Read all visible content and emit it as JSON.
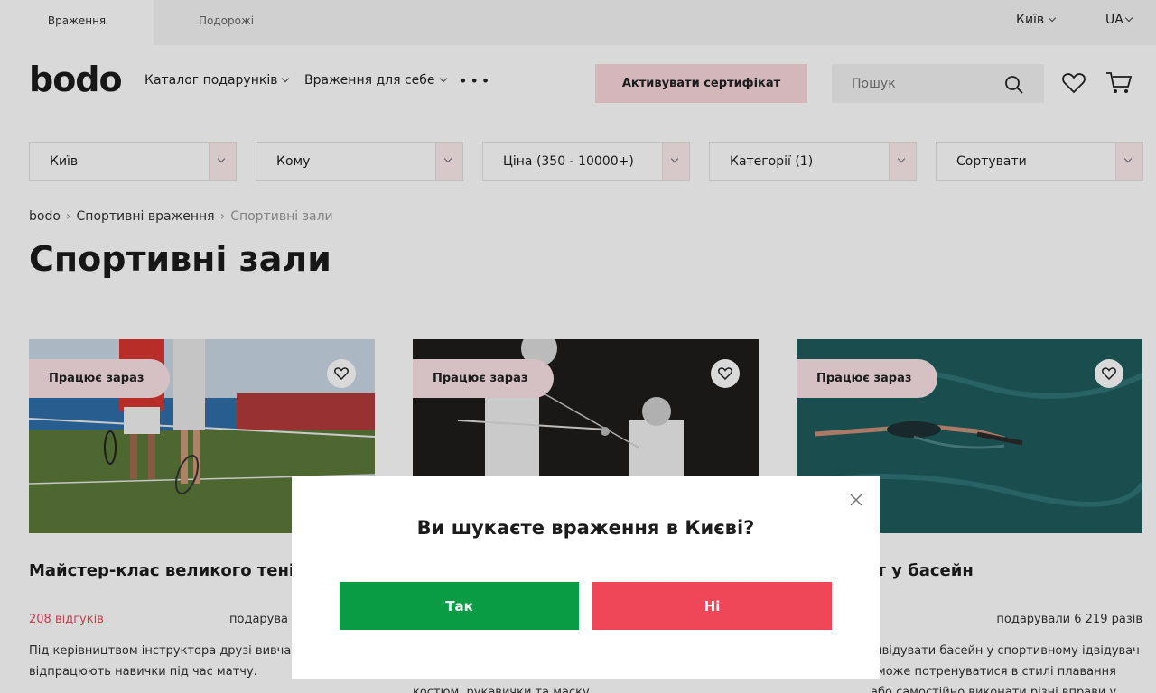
{
  "topbar": {
    "tabs": [
      "Враження",
      "Подорожі"
    ],
    "city": "Київ",
    "language": "UA"
  },
  "header": {
    "logo": "bodo",
    "nav": [
      "Каталог подарунків",
      "Враження для себе"
    ],
    "more_icon": "ellipsis-icon",
    "activate_label": "Активувати сертифікат",
    "search_placeholder": "Пошук",
    "icons": [
      "search-icon",
      "heart-icon",
      "cart-icon"
    ]
  },
  "filters": [
    {
      "label": "Київ"
    },
    {
      "label": "Кому"
    },
    {
      "label": "Ціна (350 - 10000+)"
    },
    {
      "label": "Категорії (1)"
    },
    {
      "label": "Сортувати"
    }
  ],
  "breadcrumbs": [
    "bodo",
    "Спортивні враження",
    "Спортивні зали"
  ],
  "page_title": "Спортивні зали",
  "cards": [
    {
      "badge": "Працює зараз",
      "title": "Майстер-клас великого теніс двох",
      "reviews": "208 відгуків",
      "gifted": "подарува",
      "description": "Під керівництвом інструктора друзі вивча відпрацюють навички під час матчу."
    },
    {
      "badge": "Працює зараз",
      "title": "",
      "reviews": "",
      "gifted": "",
      "description": "костюм, рукавички та маску"
    },
    {
      "badge": "Працює зараз",
      "title": "нт у басейн",
      "reviews": "",
      "gifted": "подарували 6 219 разів",
      "description": "ідвідувати басейн у спортивному ідвідувач зможе потренуватися в стилі плавання або самостійно виконати різні вправи у воді"
    }
  ],
  "modal": {
    "title": "Ви шукаєте враження в Києві?",
    "yes_label": "Так",
    "no_label": "Ні",
    "close_icon": "close-icon"
  },
  "colors": {
    "accent_pink": "#fad8dc",
    "yes_green": "#0a9b45",
    "no_red": "#ef4658",
    "link_red": "#e94a5b"
  }
}
